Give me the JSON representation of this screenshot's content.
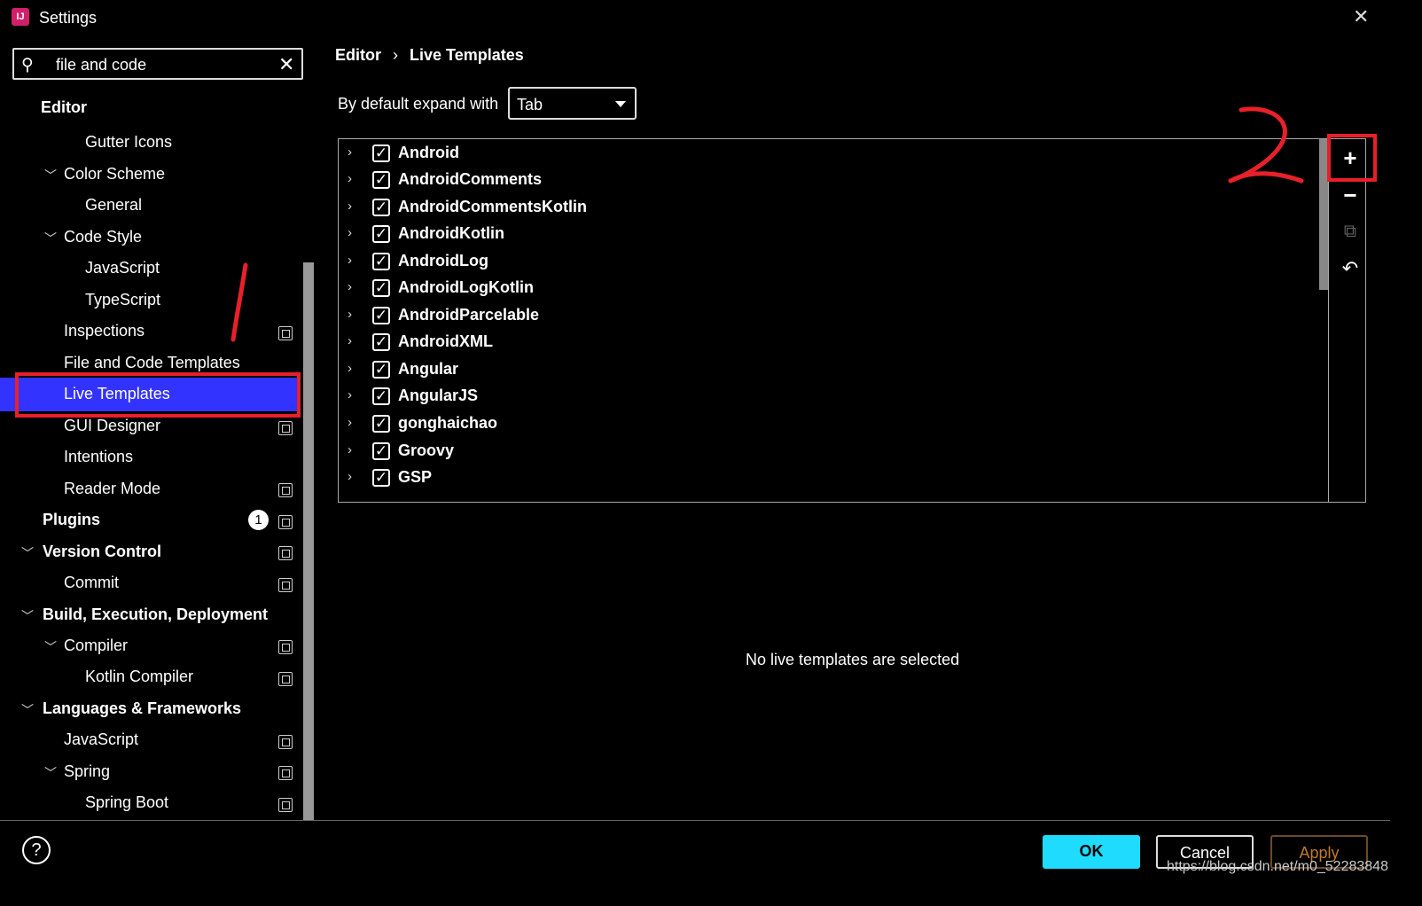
{
  "window": {
    "title": "Settings",
    "app_icon_text": "IJ"
  },
  "search": {
    "value": "file and code"
  },
  "tree": {
    "items": [
      {
        "label": "Editor"
      },
      {
        "label": "Gutter Icons"
      },
      {
        "label": "Color Scheme"
      },
      {
        "label": "General"
      },
      {
        "label": "Code Style"
      },
      {
        "label": "JavaScript"
      },
      {
        "label": "TypeScript"
      },
      {
        "label": "Inspections"
      },
      {
        "label": "File and Code Templates"
      },
      {
        "label": "Live Templates"
      },
      {
        "label": "GUI Designer"
      },
      {
        "label": "Intentions"
      },
      {
        "label": "Reader Mode"
      },
      {
        "label": "Plugins",
        "badge": "1"
      },
      {
        "label": "Version Control"
      },
      {
        "label": "Commit"
      },
      {
        "label": "Build, Execution, Deployment"
      },
      {
        "label": "Compiler"
      },
      {
        "label": "Kotlin Compiler"
      },
      {
        "label": "Languages & Frameworks"
      },
      {
        "label": "JavaScript"
      },
      {
        "label": "Spring"
      },
      {
        "label": "Spring Boot"
      }
    ],
    "selected": "Live Templates"
  },
  "breadcrumb": {
    "parent": "Editor",
    "separator": "›",
    "current": "Live Templates"
  },
  "expand": {
    "label": "By default expand with",
    "value": "Tab"
  },
  "templates": [
    {
      "label": "Android",
      "checked": true
    },
    {
      "label": "AndroidComments",
      "checked": true
    },
    {
      "label": "AndroidCommentsKotlin",
      "checked": true
    },
    {
      "label": "AndroidKotlin",
      "checked": true
    },
    {
      "label": "AndroidLog",
      "checked": true
    },
    {
      "label": "AndroidLogKotlin",
      "checked": true
    },
    {
      "label": "AndroidParcelable",
      "checked": true
    },
    {
      "label": "AndroidXML",
      "checked": true
    },
    {
      "label": "Angular",
      "checked": true
    },
    {
      "label": "AngularJS",
      "checked": true
    },
    {
      "label": "gonghaichao",
      "checked": true
    },
    {
      "label": "Groovy",
      "checked": true
    },
    {
      "label": "GSP",
      "checked": true
    }
  ],
  "empty_message": "No live templates are selected",
  "buttons": {
    "ok": "OK",
    "cancel": "Cancel",
    "apply": "Apply",
    "help": "?"
  },
  "watermark": "https://blog.csdn.net/m0_52283848",
  "annotations": {
    "mark1": "1",
    "mark2": "2",
    "color": "#e8202a"
  },
  "colors": {
    "selection": "#3333ff",
    "ok_button": "#1fdcff",
    "apply_text": "#c07a2a"
  }
}
